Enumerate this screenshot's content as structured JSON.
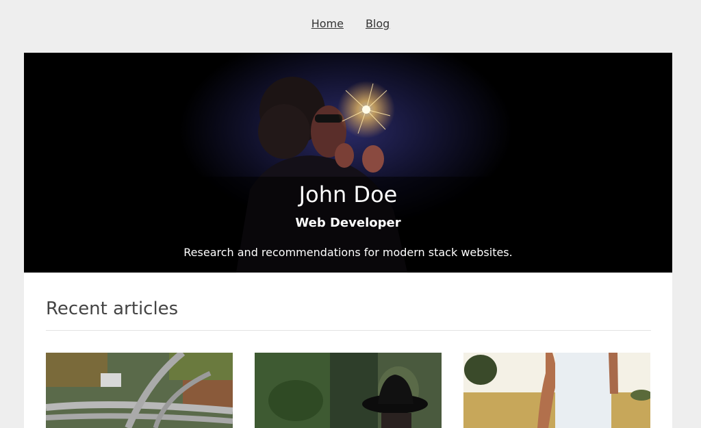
{
  "nav": {
    "items": [
      {
        "label": "Home"
      },
      {
        "label": "Blog"
      }
    ]
  },
  "hero": {
    "name": "John Doe",
    "role": "Web Developer",
    "tagline": "Research and recommendations for modern stack websites."
  },
  "recent": {
    "title": "Recent articles",
    "articles": [
      {
        "image": "aerial-highway-photo"
      },
      {
        "image": "person-black-hat-forest-photo"
      },
      {
        "image": "tattooed-arm-wheat-field-photo"
      }
    ]
  },
  "colors": {
    "page_bg": "#eeeeee",
    "hero_bg": "#000000",
    "content_bg": "#ffffff"
  }
}
